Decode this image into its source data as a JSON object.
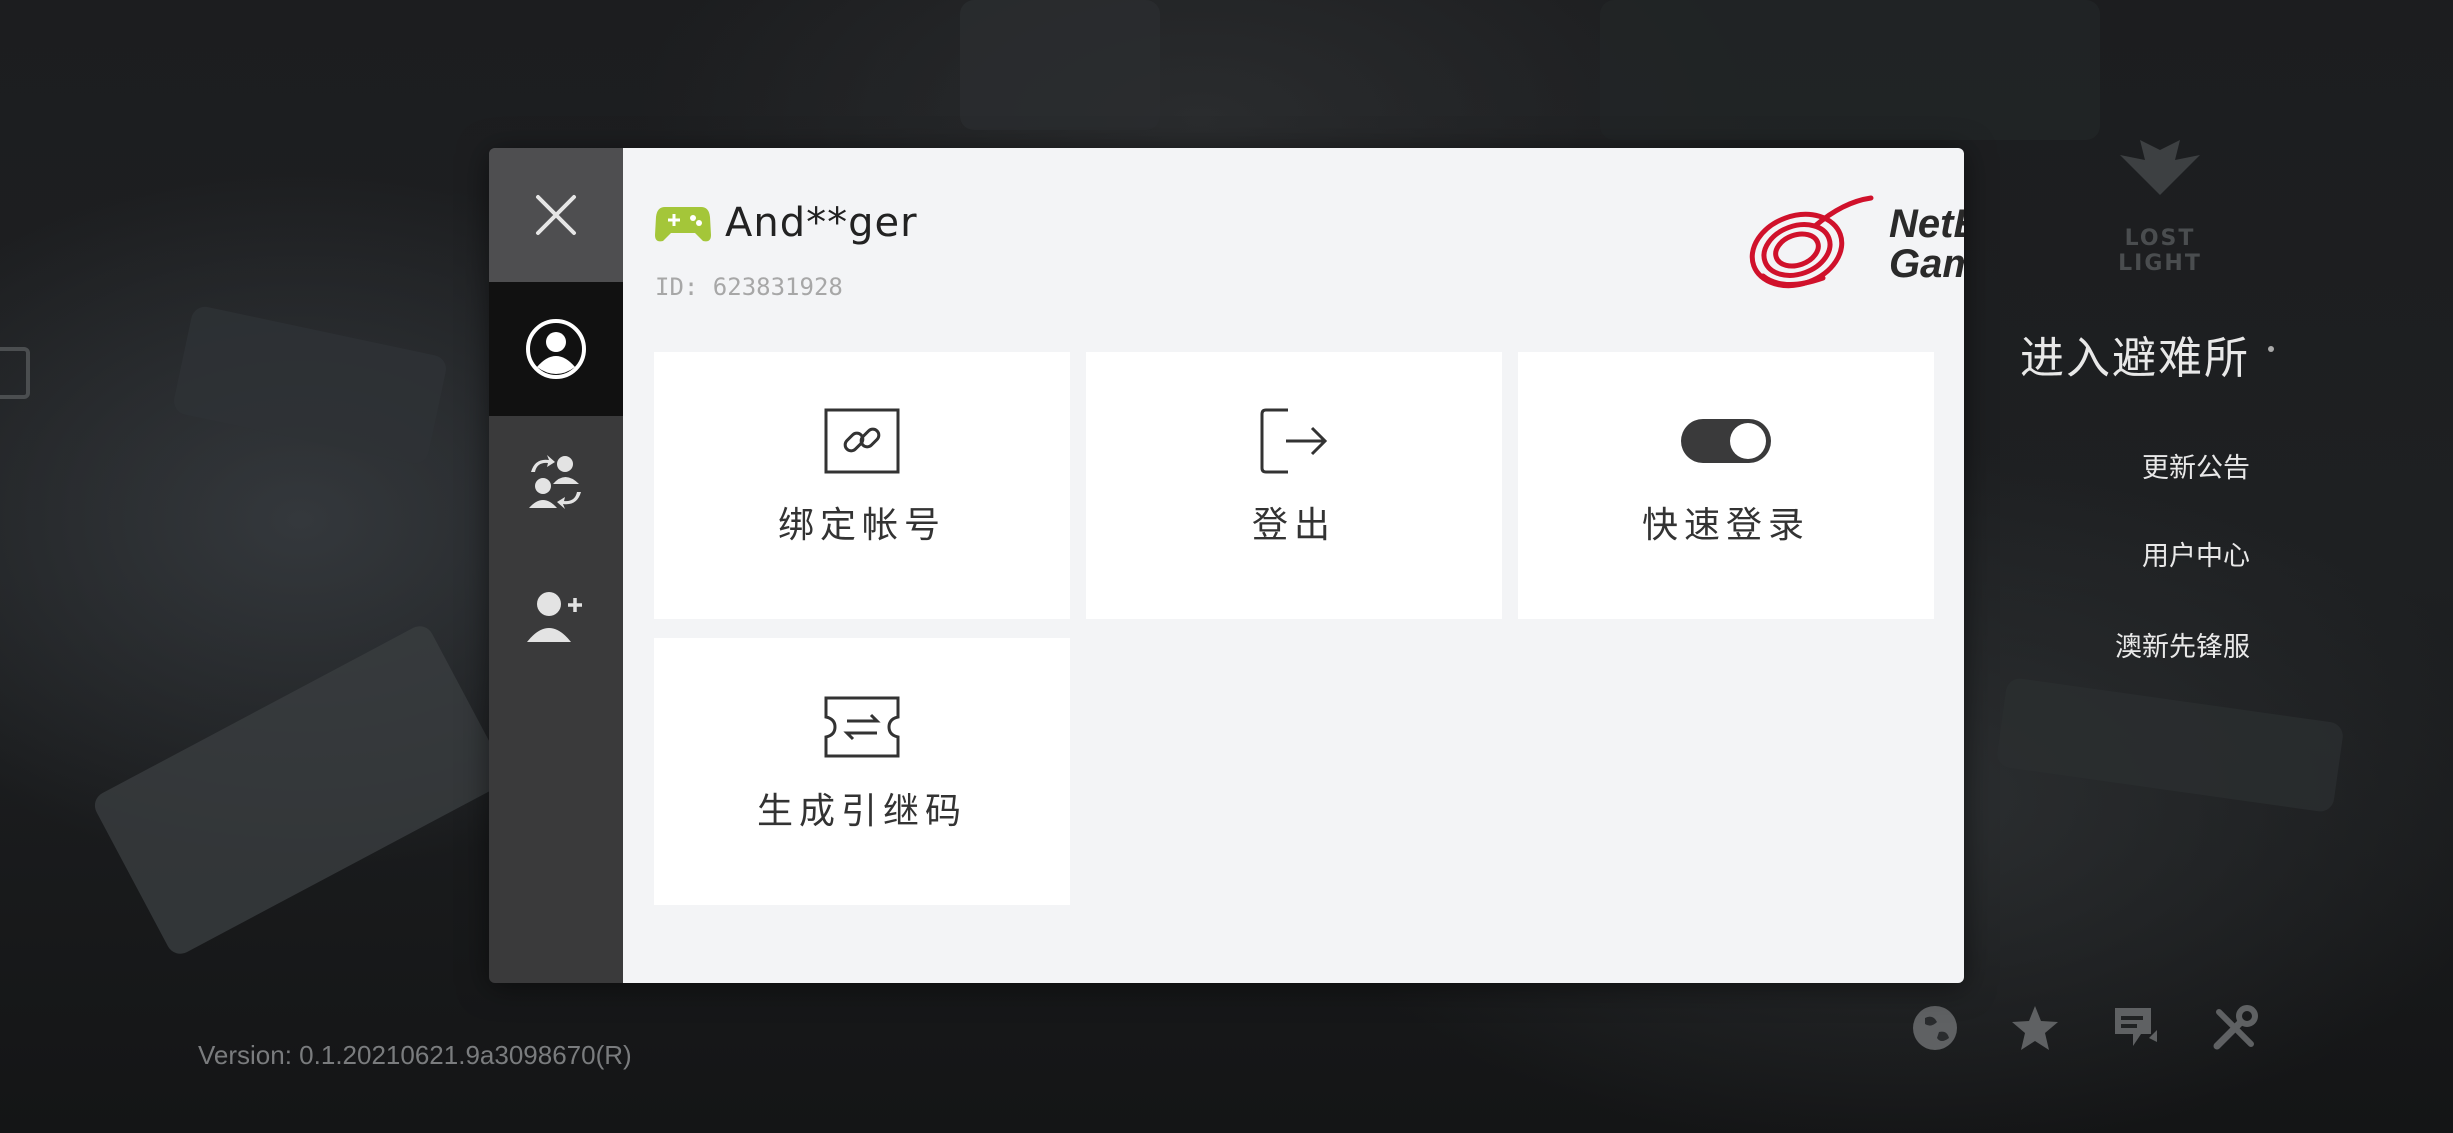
{
  "background": {
    "game_logo_text": "LOST LIGHT"
  },
  "right_menu": {
    "enter_label": "进入避难所",
    "links": [
      "更新公告",
      "用户中心",
      "澳新先锋服"
    ]
  },
  "version_text": "Version: 0.1.20210621.9a3098670(R)",
  "bottom_icons": [
    "globe-icon",
    "star-icon",
    "feedback-icon",
    "tools-icon"
  ],
  "dialog": {
    "side": {
      "close_icon": "close-icon",
      "items": [
        "account-icon",
        "switch-account-icon",
        "add-account-icon"
      ],
      "active_index": 0
    },
    "user": {
      "avatar_icon": "gamepad-icon",
      "name": "And**ger",
      "id_text": "ID: 623831928"
    },
    "brand": {
      "line1": "NetEase",
      "line2": "Games",
      "color": "#d0112b"
    },
    "cards": [
      {
        "label": "绑定帐号",
        "icon": "link-icon"
      },
      {
        "label": "登出",
        "icon": "logout-icon"
      },
      {
        "label": "快速登录",
        "icon": "toggle-icon",
        "toggle_on": true
      },
      {
        "label": "生成引继码",
        "icon": "transfer-ticket-icon"
      }
    ]
  },
  "colors": {
    "gamepad": "#a4c639",
    "dialog_bg": "#f3f4f6",
    "sidebar": "#3a3a3b",
    "sidebar_active": "#111111"
  }
}
